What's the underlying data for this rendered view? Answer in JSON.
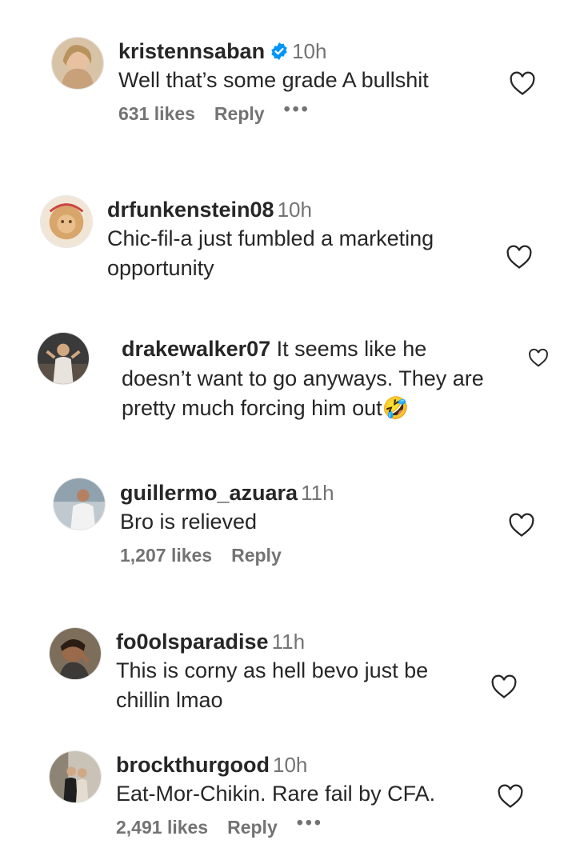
{
  "comments": [
    {
      "username": "kristennsaban",
      "time": "10h",
      "verified": true,
      "text": "Well that’s some grade A bullshit",
      "likes": "631 likes",
      "reply": "Reply",
      "more": "•••"
    },
    {
      "username": "drfunkenstein08",
      "time": "10h",
      "text": "Chic-fil-a just fumbled a marketing opportunity"
    },
    {
      "username": "drakewalker07",
      "text": "It seems like he doesn’t want to go anyways. They are pretty much forcing him out🤣"
    },
    {
      "username": "guillermo_azuara",
      "time": "11h",
      "text": "Bro is relieved",
      "likes": "1,207 likes",
      "reply": "Reply"
    },
    {
      "username": "fo0olsparadise",
      "time": "11h",
      "text": "This is corny as hell bevo just be chillin lmao"
    },
    {
      "username": "brockthurgood",
      "time": "10h",
      "text": "Eat-Mor-Chikin. Rare fail by CFA.",
      "likes": "2,491 likes",
      "reply": "Reply",
      "more": "•••"
    }
  ],
  "colors": {
    "verified_badge": "#0095f6",
    "secondary_text": "#737373"
  },
  "icons": [
    "heart-outline-icon",
    "verified-badge-icon",
    "more-options-icon"
  ]
}
